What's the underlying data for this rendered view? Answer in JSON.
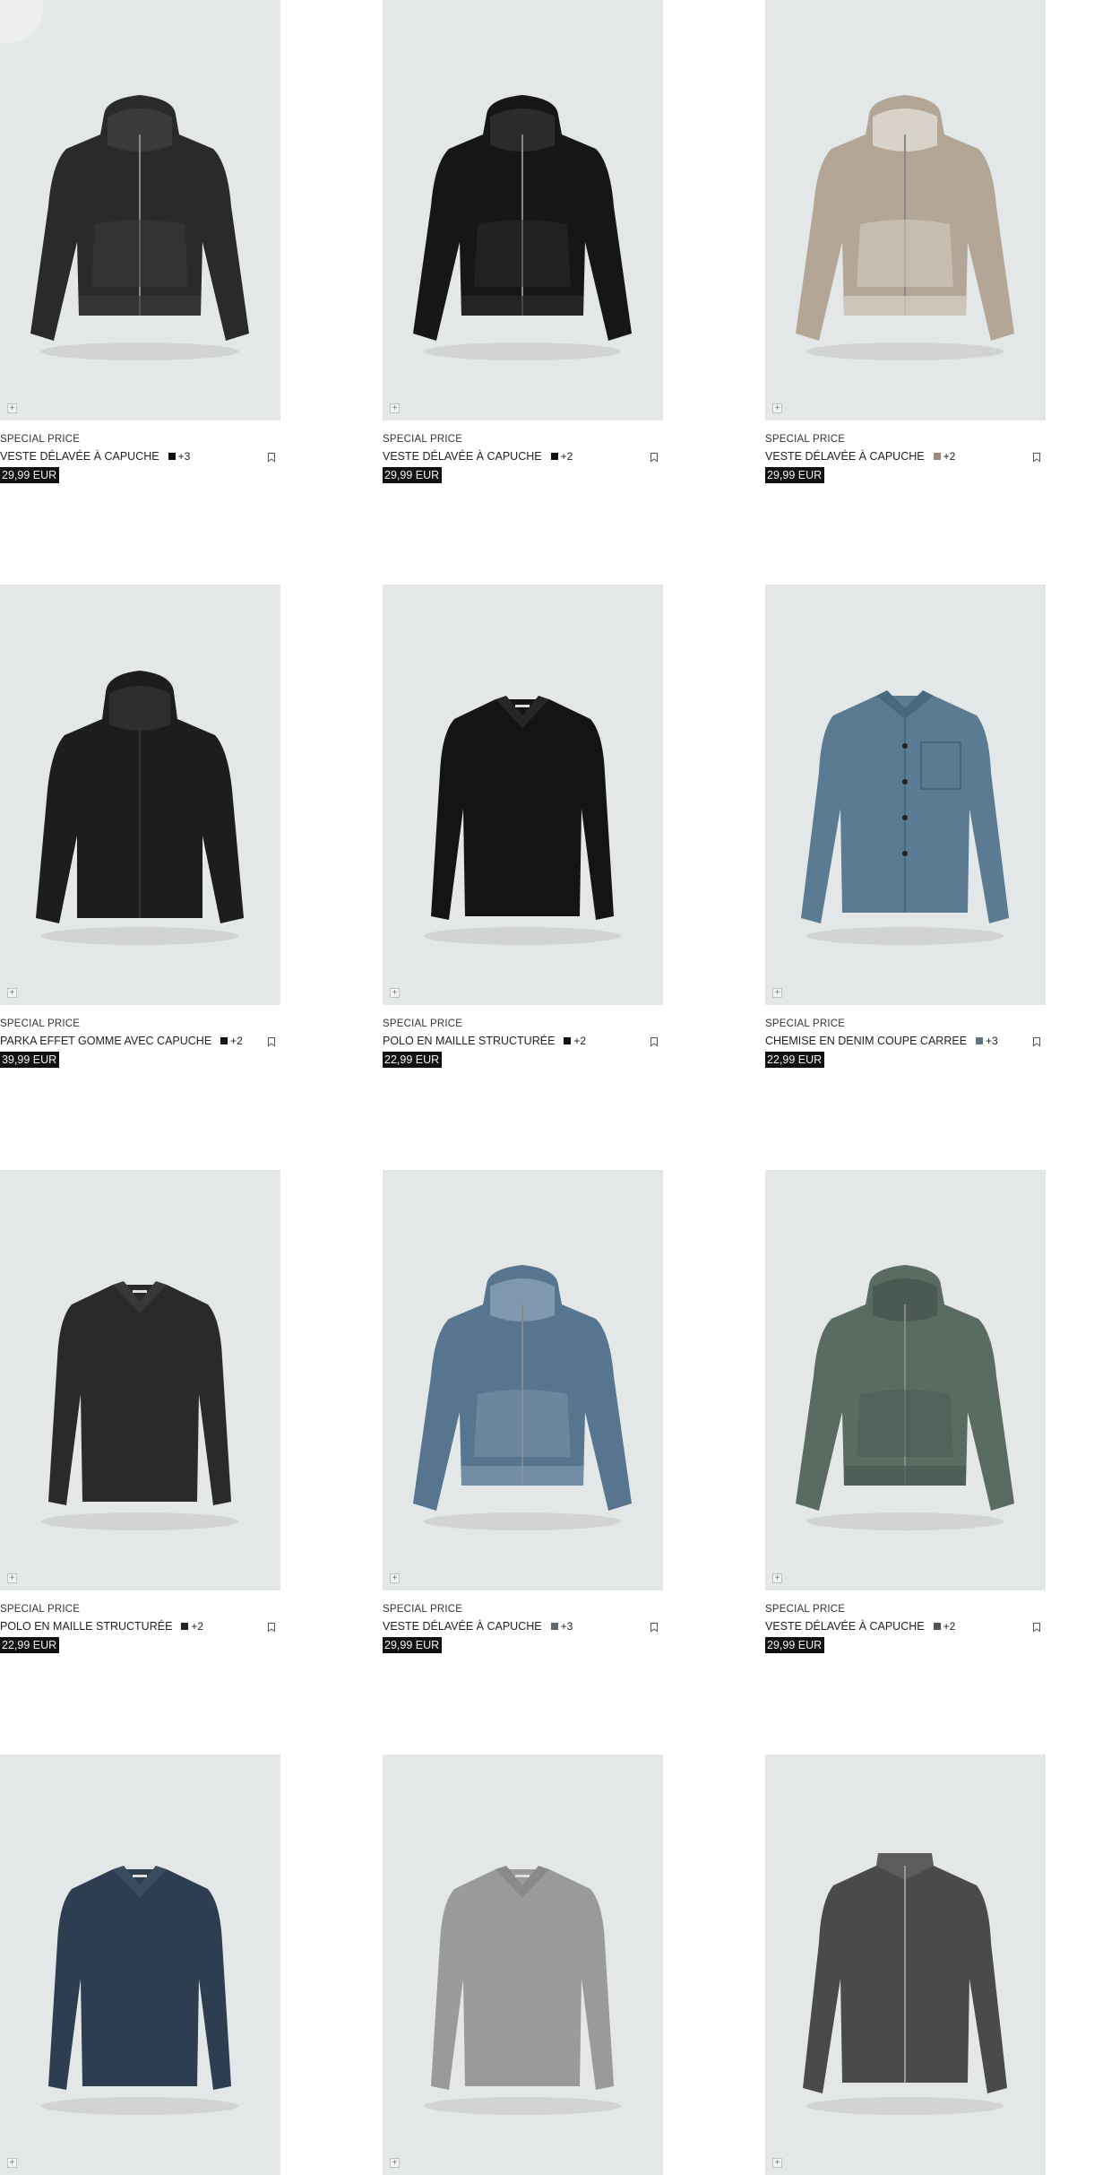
{
  "products": [
    {
      "label": "SPECIAL PRICE",
      "name": "VESTE DÉLAVÉE À CAPUCHE",
      "swatch": "#111111",
      "more": "+3",
      "price": "29,99 EUR",
      "garment": "hooded-jacket",
      "color": "#2a2a2a",
      "accent": "#3a3a3a",
      "icon": "hooded-jacket-icon"
    },
    {
      "label": "SPECIAL PRICE",
      "name": "VESTE DÉLAVÉE À CAPUCHE",
      "swatch": "#111111",
      "more": "+2",
      "price": "29,99 EUR",
      "garment": "hooded-jacket",
      "color": "#161616",
      "accent": "#2b2b2b",
      "icon": "hooded-jacket-icon"
    },
    {
      "label": "SPECIAL PRICE",
      "name": "VESTE DÉLAVÉE À CAPUCHE",
      "swatch": "#9a8a7c",
      "more": "+2",
      "price": "29,99 EUR",
      "garment": "hooded-jacket",
      "color": "#b4a696",
      "accent": "#d8d2c8",
      "icon": "hooded-jacket-icon"
    },
    {
      "label": "SPECIAL PRICE",
      "name": "PARKA EFFET GOMME AVEC CAPUCHE",
      "swatch": "#111111",
      "more": "+2",
      "price": "39,99 EUR",
      "garment": "parka",
      "color": "#1d1d1d",
      "accent": "#2e2e2e",
      "icon": "parka-icon"
    },
    {
      "label": "SPECIAL PRICE",
      "name": "POLO EN MAILLE STRUCTURÉE",
      "swatch": "#111111",
      "more": "+2",
      "price": "22,99 EUR",
      "garment": "polo",
      "color": "#141414",
      "accent": "#262626",
      "icon": "polo-icon"
    },
    {
      "label": "SPECIAL PRICE",
      "name": "CHEMISE EN DENIM COUPE CARREE",
      "swatch": "#5f7686",
      "more": "+3",
      "price": "22,99 EUR",
      "garment": "shirt",
      "color": "#5a7b91",
      "accent": "#47687d",
      "icon": "shirt-icon"
    },
    {
      "label": "SPECIAL PRICE",
      "name": "POLO EN MAILLE STRUCTURÉE",
      "swatch": "#222222",
      "more": "+2",
      "price": "22,99 EUR",
      "garment": "polo",
      "color": "#2b2929",
      "accent": "#3a3737",
      "icon": "polo-icon"
    },
    {
      "label": "SPECIAL PRICE",
      "name": "VESTE DÉLAVÉE À CAPUCHE",
      "swatch": "#5c6b70",
      "more": "+3",
      "price": "29,99 EUR",
      "garment": "hooded-jacket",
      "color": "#58758f",
      "accent": "#7f98ad",
      "icon": "hooded-jacket-icon"
    },
    {
      "label": "SPECIAL PRICE",
      "name": "VESTE DÉLAVÉE À CAPUCHE",
      "swatch": "#4f5552",
      "more": "+2",
      "price": "29,99 EUR",
      "garment": "hooded-jacket",
      "color": "#5a6b62",
      "accent": "#4a5a52",
      "icon": "hooded-jacket-icon"
    },
    {
      "label": "",
      "name": "",
      "swatch": "",
      "more": "",
      "price": "",
      "garment": "polo",
      "color": "#2c3e4f",
      "accent": "#3a4d5f",
      "icon": "polo-icon"
    },
    {
      "label": "",
      "name": "",
      "swatch": "",
      "more": "",
      "price": "",
      "garment": "polo",
      "color": "#9a9a9a",
      "accent": "#8a8a8a",
      "icon": "polo-icon"
    },
    {
      "label": "",
      "name": "",
      "swatch": "",
      "more": "",
      "price": "",
      "garment": "zip-jacket",
      "color": "#4a4a4a",
      "accent": "#5c5c5c",
      "icon": "zip-jacket-icon"
    }
  ],
  "icons": {
    "add": "+",
    "bookmark": "bookmark-icon"
  }
}
